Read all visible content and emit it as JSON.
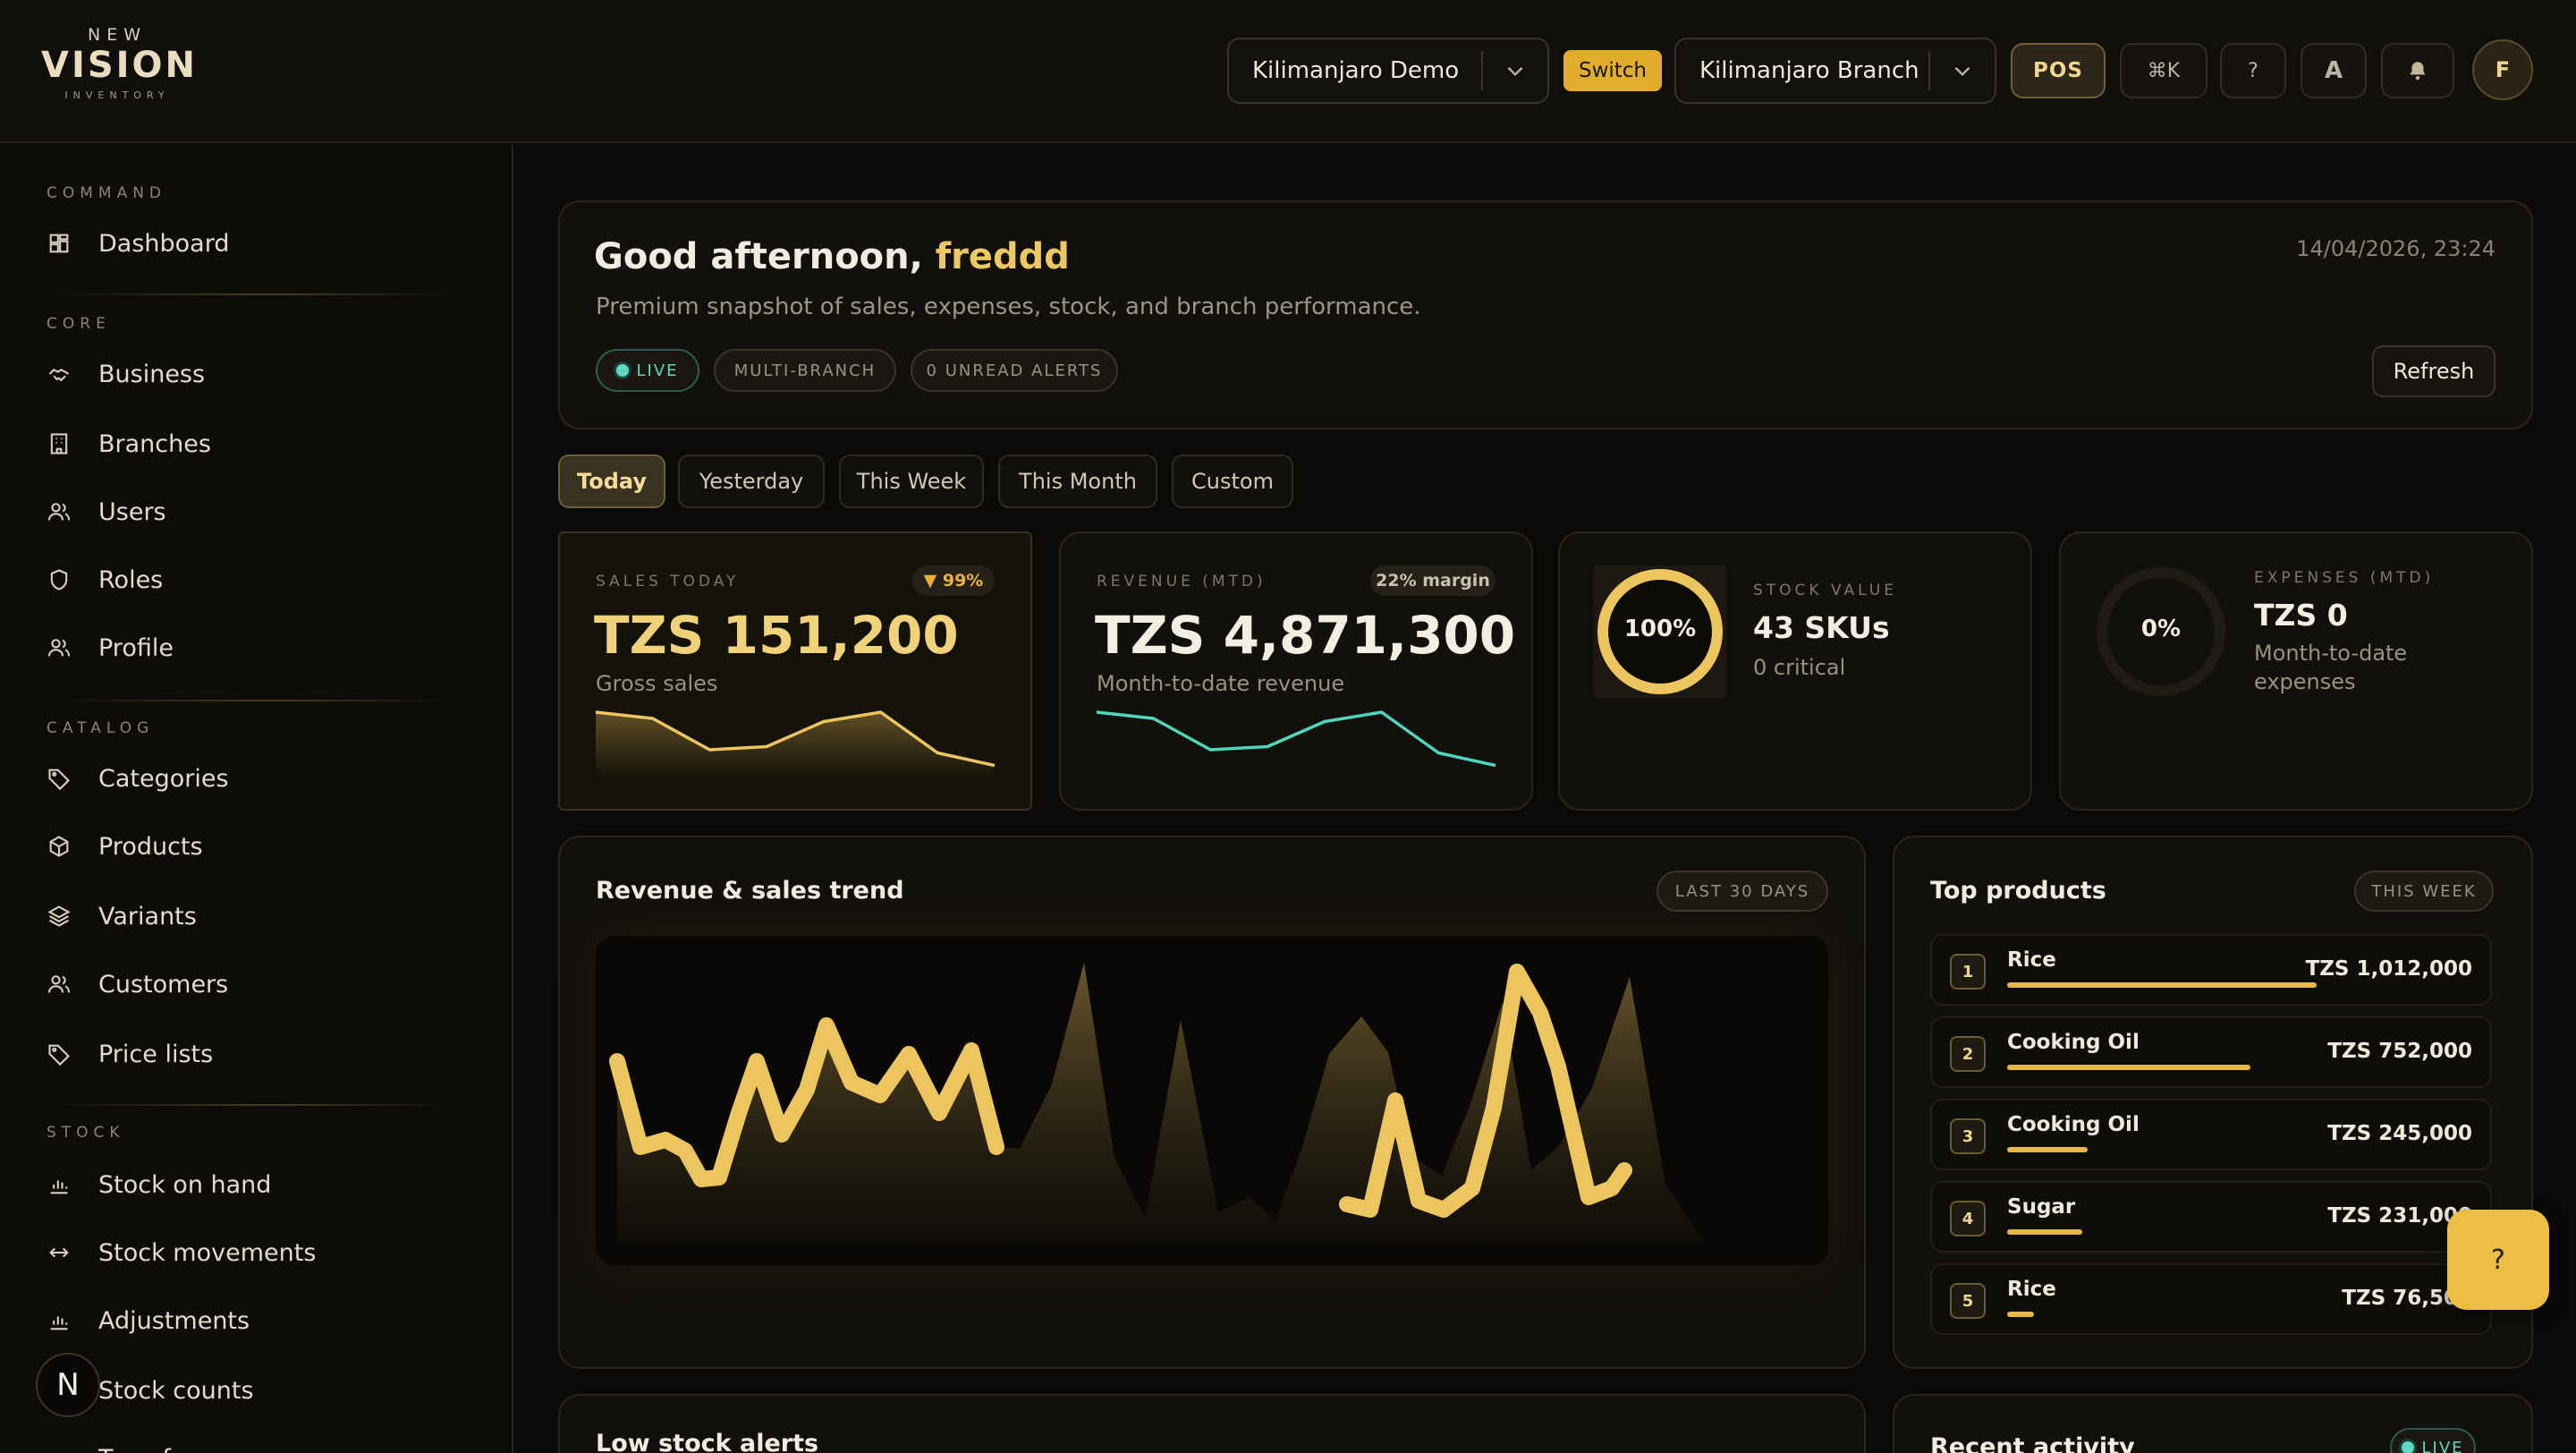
{
  "brand": {
    "top": "NEW",
    "name": "VISION",
    "sub": "INVENTORY"
  },
  "header": {
    "business": "Kilimanjaro Demo",
    "switch_label": "Switch",
    "branch": "Kilimanjaro Branch",
    "pos_label": "POS",
    "shortcut_label": "⌘K",
    "help_label": "?",
    "font_label": "A",
    "bell_icon": "bell-icon",
    "avatar_initial": "F"
  },
  "sidebar": {
    "sections": [
      {
        "label": "COMMAND",
        "items": [
          {
            "label": "Dashboard",
            "icon": "dashboard-icon"
          }
        ]
      },
      {
        "label": "CORE",
        "items": [
          {
            "label": "Business",
            "icon": "handshake-icon"
          },
          {
            "label": "Branches",
            "icon": "building-icon"
          },
          {
            "label": "Users",
            "icon": "users-icon"
          },
          {
            "label": "Roles",
            "icon": "shield-icon"
          },
          {
            "label": "Profile",
            "icon": "users-icon"
          }
        ]
      },
      {
        "label": "CATALOG",
        "items": [
          {
            "label": "Categories",
            "icon": "tag-icon"
          },
          {
            "label": "Products",
            "icon": "box-icon"
          },
          {
            "label": "Variants",
            "icon": "layers-icon"
          },
          {
            "label": "Customers",
            "icon": "users-icon"
          },
          {
            "label": "Price lists",
            "icon": "tag-icon"
          }
        ]
      },
      {
        "label": "STOCK",
        "items": [
          {
            "label": "Stock on hand",
            "icon": "bar-chart-icon"
          },
          {
            "label": "Stock movements",
            "icon": "arrows-horizontal-icon"
          },
          {
            "label": "Adjustments",
            "icon": "bar-chart-icon"
          },
          {
            "label": "Stock counts",
            "icon": "bar-chart-icon"
          },
          {
            "label": "Transfers",
            "icon": "arrows-horizontal-icon"
          }
        ]
      }
    ],
    "badge": "N"
  },
  "greeting": {
    "prefix": "Good afternoon,",
    "name": "freddd",
    "subtitle": "Premium snapshot of sales, expenses, stock, and branch performance.",
    "datetime": "14/04/2026, 23:24",
    "pills": [
      "LIVE",
      "MULTI-BRANCH",
      "0 UNREAD ALERTS"
    ],
    "refresh": "Refresh"
  },
  "period_tabs": [
    "Today",
    "Yesterday",
    "This Week",
    "This Month",
    "Custom"
  ],
  "active_period": "Today",
  "stats": {
    "sales": {
      "label": "SALES TODAY",
      "chip": "▼ 99%",
      "value": "TZS 151,200",
      "sub": "Gross sales",
      "spark": [
        40,
        36,
        16,
        18,
        34,
        40,
        14,
        6
      ]
    },
    "revenue": {
      "label": "REVENUE (MTD)",
      "chip": "22% margin",
      "value": "TZS 4,871,300",
      "sub": "Month-to-date revenue",
      "spark": [
        40,
        36,
        16,
        18,
        34,
        40,
        14,
        6
      ]
    },
    "stock": {
      "label": "STOCK VALUE",
      "ring": "100%",
      "ring_fraction": 1.0,
      "value": "43 SKUs",
      "sub": "0 critical"
    },
    "expenses": {
      "label": "EXPENSES (MTD)",
      "ring": "0%",
      "ring_fraction": 0.0,
      "value": "TZS 0",
      "sub": "Month-to-date expenses"
    }
  },
  "trend": {
    "title": "Revenue & sales trend",
    "chip": "LAST 30 DAYS"
  },
  "top_products": {
    "title": "Top products",
    "chip": "THIS WEEK",
    "items": [
      {
        "rank": "1",
        "name": "Rice",
        "value": "TZS 1,012,000",
        "share": 1.0
      },
      {
        "rank": "2",
        "name": "Cooking Oil",
        "value": "TZS 752,000",
        "share": 0.78
      },
      {
        "rank": "3",
        "name": "Cooking Oil",
        "value": "TZS 245,000",
        "share": 0.26
      },
      {
        "rank": "4",
        "name": "Sugar",
        "value": "TZS 231,000",
        "share": 0.24
      },
      {
        "rank": "5",
        "name": "Rice",
        "value": "TZS 76,500",
        "share": 0.08
      }
    ]
  },
  "lower": {
    "low_stock_title": "Low stock alerts",
    "activity_title": "Recent activity",
    "activity_chip": "LIVE"
  },
  "help_fab": "?",
  "colors": {
    "accent": "#ecc862",
    "teal": "#5ed8be",
    "bg": "#0b0a08"
  }
}
